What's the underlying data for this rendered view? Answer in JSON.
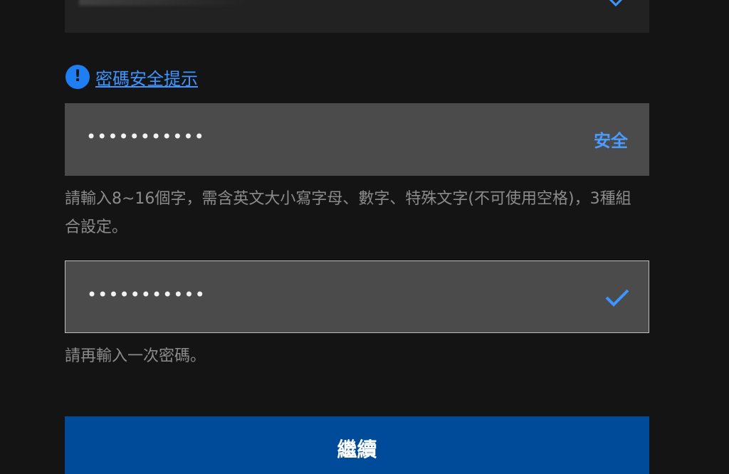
{
  "top_field": {
    "icon": "chevron-down-icon"
  },
  "tip": {
    "icon": "info-icon",
    "icon_glyph": "!",
    "link_label": "密碼安全提示"
  },
  "password": {
    "value": "•••••••••••",
    "strength_label": "安全",
    "hint": "請輸入8~16個字，需含英文大小寫字母、數字、特殊文字(不可使用空格)，3種組合設定。"
  },
  "confirm_password": {
    "value": "•••••••••••",
    "icon": "check-icon",
    "hint": "請再輸入一次密碼。"
  },
  "continue_button": {
    "label": "繼續"
  },
  "colors": {
    "background": "#141414",
    "field": "#4b4b4b",
    "accent": "#3d95ff",
    "button": "#004b99"
  }
}
